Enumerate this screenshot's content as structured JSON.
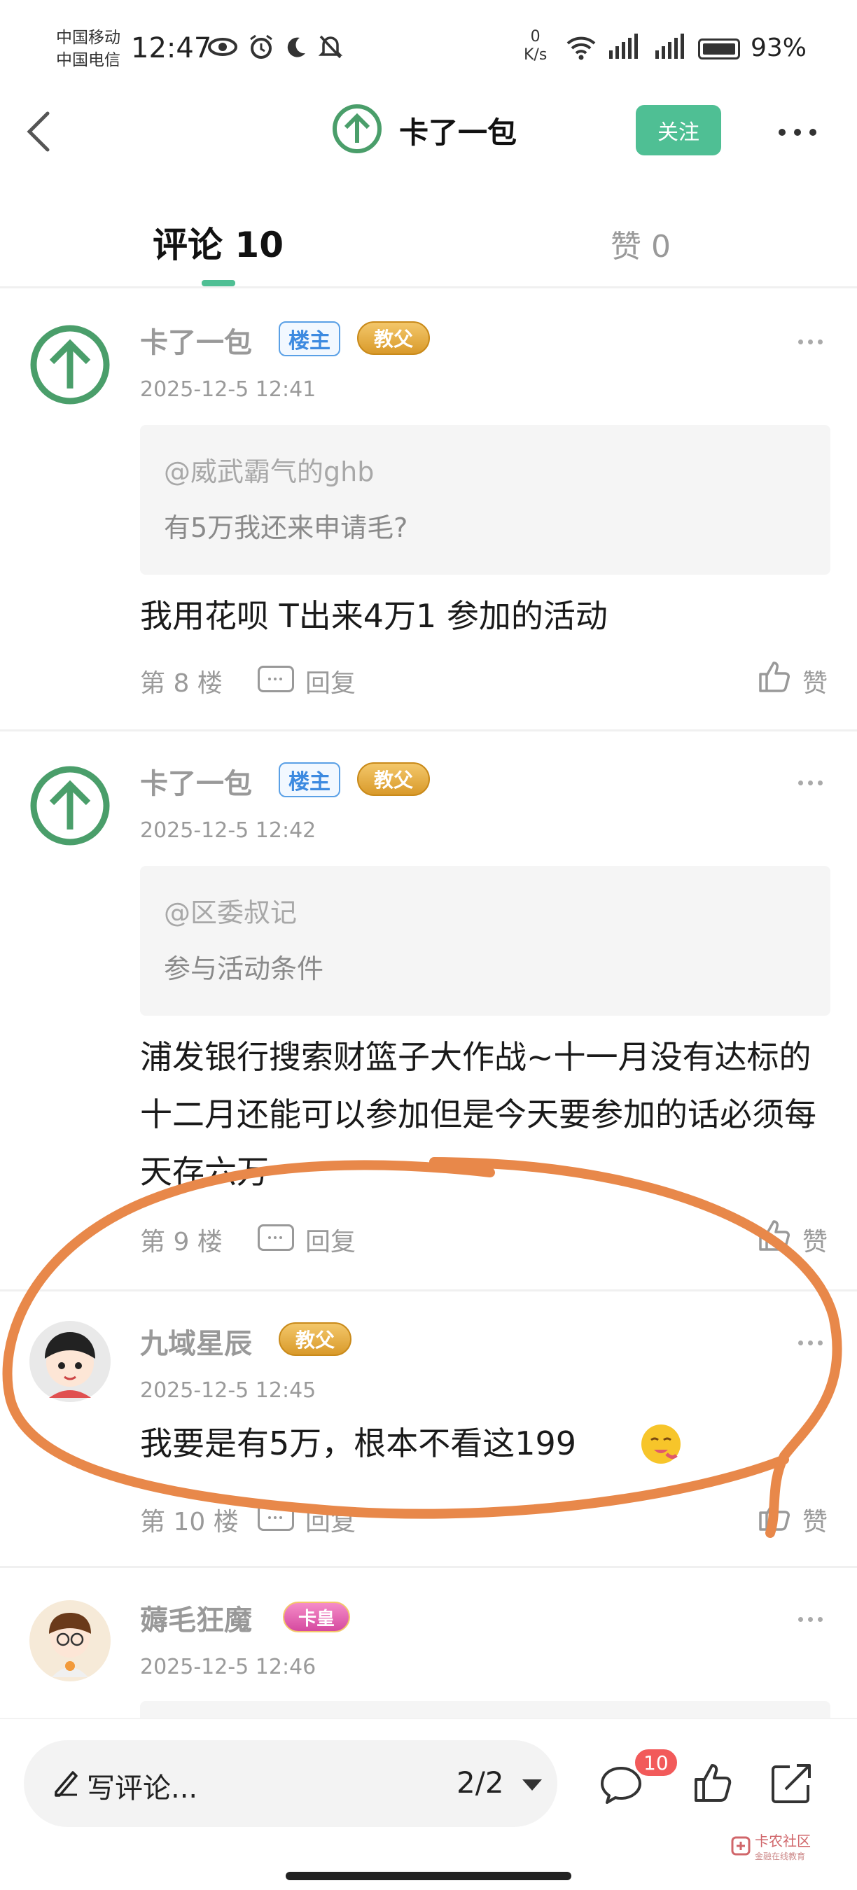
{
  "status_bar": {
    "carrier_1": "中国移动",
    "carrier_2": "中国电信",
    "time": "12:47",
    "net_speed_value": "0",
    "net_speed_unit": "K/s",
    "battery": "93%"
  },
  "header": {
    "title": "卡了一包",
    "follow_label": "关注"
  },
  "tabs": {
    "comments_label": "评论 10",
    "likes_label": "赞 0"
  },
  "comments": [
    {
      "author": "卡了一包",
      "owner_badge": "楼主",
      "rank_badge": "教父",
      "time": "2025-12-5 12:41",
      "quote_at": "@威武霸气的ghb",
      "quote_text": "有5万我还来申请毛?",
      "body": "我用花呗 T出来4万1 参加的活动",
      "floor": "第 8 楼",
      "reply_label": "回复",
      "like_label": "赞"
    },
    {
      "author": "卡了一包",
      "owner_badge": "楼主",
      "rank_badge": "教父",
      "time": "2025-12-5 12:42",
      "quote_at": "@区委叔记",
      "quote_text": "参与活动条件",
      "body": "浦发银行搜索财篮子大作战~十一月没有达标的十二月还能可以参加但是今天要参加的话必须每天存六万",
      "floor": "第 9 楼",
      "reply_label": "回复",
      "like_label": "赞"
    },
    {
      "author": "九域星辰",
      "rank_badge": "教父",
      "time": "2025-12-5 12:45",
      "body": "我要是有5万，根本不看这199",
      "floor": "第 10 楼",
      "reply_label": "回复",
      "like_label": "赞"
    },
    {
      "author": "薅毛狂魔",
      "rank_badge": "卡皇",
      "time": "2025-12-5 12:46"
    }
  ],
  "bottom_bar": {
    "write_placeholder": "写评论...",
    "page_indicator": "2/2",
    "comment_count": "10",
    "watermark": "卡农社区",
    "watermark_sub": "金融在线教育"
  },
  "colors": {
    "accent": "#4fbf94",
    "badge_red": "#f25a5a",
    "annotation": "#e8884a"
  },
  "icons": [
    "back-arrow-icon",
    "up-arrow-avatar-icon",
    "more-icon",
    "reply-icon",
    "thumbs-up-icon",
    "pen-icon",
    "comment-icon",
    "share-icon",
    "emoji-icon"
  ]
}
